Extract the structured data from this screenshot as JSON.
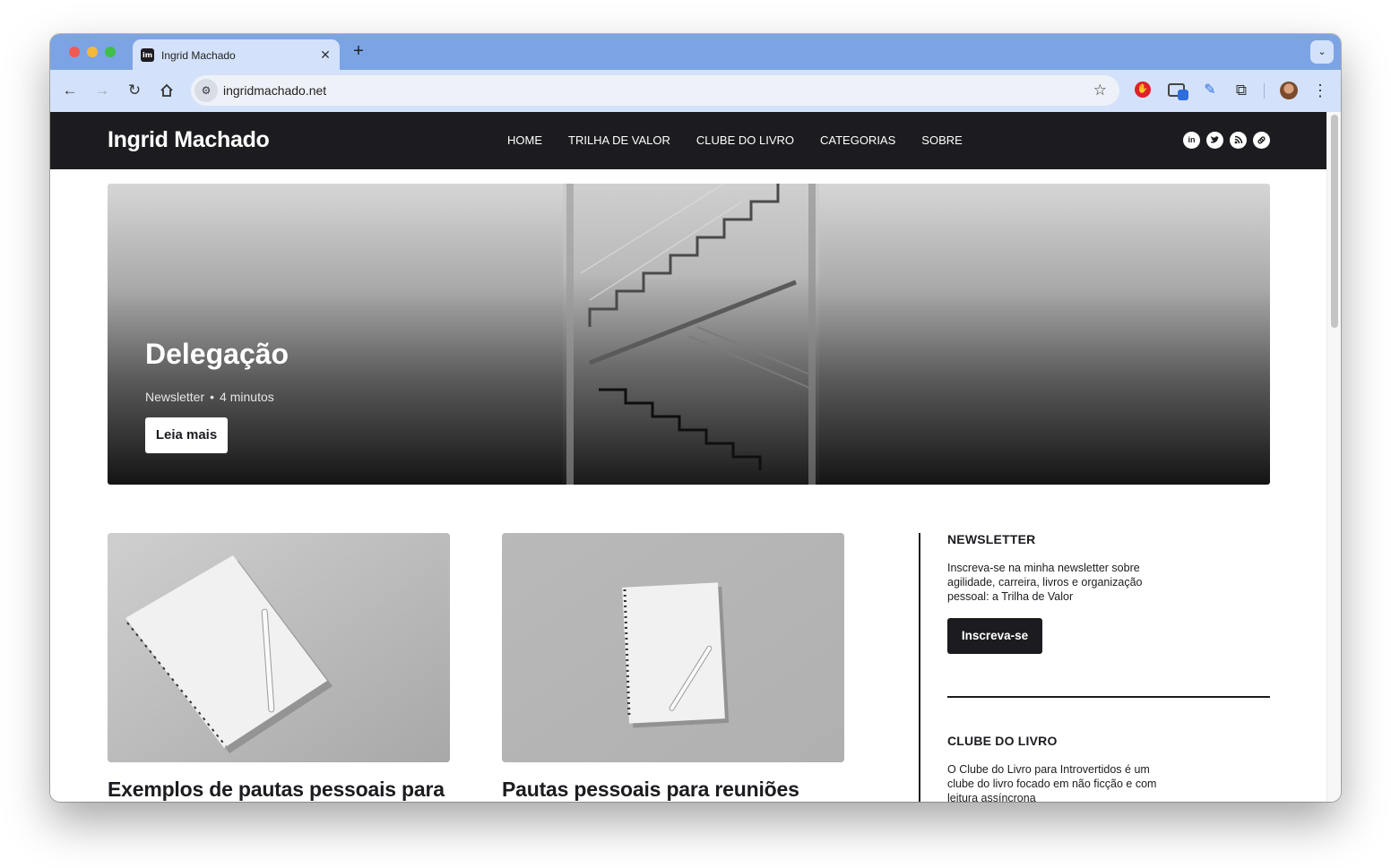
{
  "browser": {
    "tab_title": "Ingrid Machado",
    "favicon_text": "im",
    "tab_close": "✕",
    "new_tab": "+",
    "tab_menu": "⌄",
    "url": "ingridmachado.net",
    "icons": [
      "back-arrow-icon",
      "forward-arrow-icon",
      "reload-icon",
      "home-icon",
      "site-info-icon",
      "bookmark-star-icon",
      "adblock-extension-icon",
      "cast-extension-icon",
      "writing-extension-icon",
      "extensions-puzzle-icon",
      "profile-avatar",
      "more-menu-icon"
    ]
  },
  "site": {
    "logo": "Ingrid Machado",
    "nav": [
      "HOME",
      "TRILHA DE VALOR",
      "CLUBE DO LIVRO",
      "CATEGORIAS",
      "SOBRE"
    ],
    "socials": [
      "linkedin-icon",
      "twitter-icon",
      "rss-icon",
      "link-icon"
    ]
  },
  "hero": {
    "title": "Delegação",
    "category": "Newsletter",
    "separator": "•",
    "read_time": "4 minutos",
    "button": "Leia mais"
  },
  "posts": [
    {
      "title": "Exemplos de pautas pessoais para"
    },
    {
      "title": "Pautas pessoais para reuniões"
    }
  ],
  "sidebar": {
    "newsletter": {
      "title": "NEWSLETTER",
      "text": "Inscreva-se na minha newsletter sobre agilidade, carreira, livros e organização pessoal: a Trilha de Valor",
      "button": "Inscreva-se"
    },
    "book_club": {
      "title": "CLUBE DO LIVRO",
      "text": "O Clube do Livro para Introvertidos é um clube do livro focado em não ficção e com leitura assíncrona"
    }
  },
  "colors": {
    "brand_dark": "#1c1c20",
    "tab_bar": "#7ca4e4",
    "toolbar": "#d3e2fa"
  }
}
